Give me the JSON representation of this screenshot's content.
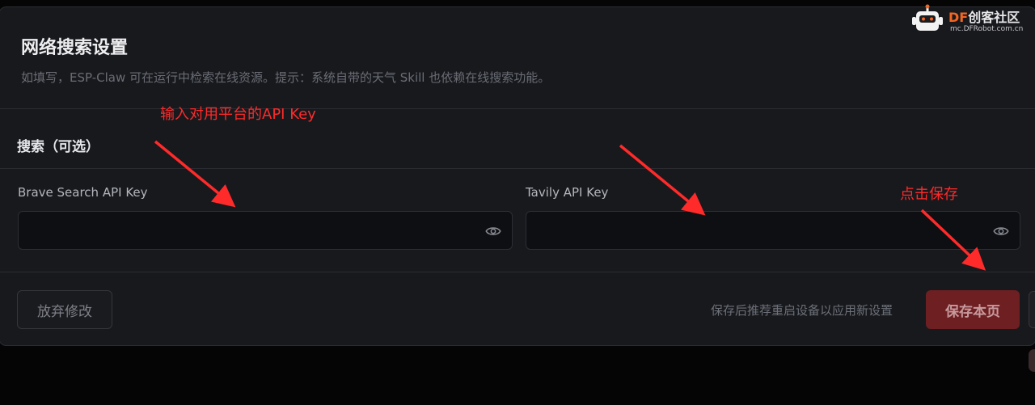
{
  "header": {
    "title": "网络搜索设置",
    "subtitle": "如填写，ESP-Claw 可在运行中检索在线资源。提示：系统自带的天气 Skill 也依赖在线搜索功能。"
  },
  "section": {
    "title": "搜索（可选）"
  },
  "fields": [
    {
      "label": "Brave Search API Key",
      "value": "",
      "icon": "eye-icon"
    },
    {
      "label": "Tavily API Key",
      "value": "",
      "icon": "eye-icon"
    }
  ],
  "footer": {
    "discard_label": "放弃修改",
    "hint": "保存后推荐重启设备以应用新设置",
    "save_label": "保存本页"
  },
  "annotations": {
    "input_hint": "输入对用平台的API Key",
    "save_hint": "点击保存",
    "color": "#ff2a2a"
  },
  "watermark": {
    "brand_prefix": "DF",
    "brand_suffix": "创客社区",
    "url": "mc.DFRobot.com.cn"
  },
  "colors": {
    "panel_bg": "#18191d",
    "save_button": "#6e1f22",
    "brand_orange": "#f26522"
  }
}
